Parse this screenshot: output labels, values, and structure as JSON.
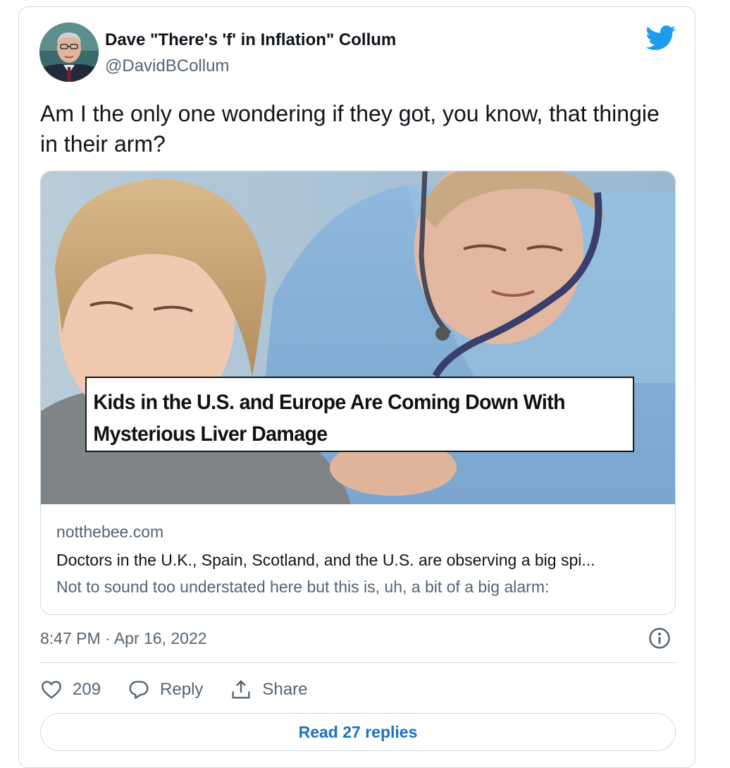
{
  "author": {
    "name": "Dave \"There's 'f' in Inflation\" Collum",
    "handle": "@DavidBCollum"
  },
  "tweet": {
    "text": "Am I the only one wondering if they got, you know, that thingie in their arm?",
    "timestamp": "8:47 PM · Apr 16, 2022"
  },
  "card": {
    "headline_line1": "Kids in the U.S. and Europe Are Coming Down With",
    "headline_line2": "Mysterious Liver Damage",
    "domain": "notthebee.com",
    "title": "Doctors in the U.K., Spain, Scotland, and the U.S. are observing a big spi...",
    "description": "Not to sound too understated here but this is, uh, a bit of a big alarm:"
  },
  "actions": {
    "likes": "209",
    "reply_label": "Reply",
    "share_label": "Share"
  },
  "read_replies_label": "Read 27 replies",
  "icons": {
    "brand": "twitter-bird-icon",
    "info": "info-icon",
    "like": "heart-icon",
    "reply": "speech-bubble-icon",
    "share": "share-upload-icon"
  },
  "colors": {
    "twitter_blue": "#1d9bf0",
    "link_blue": "#1d6fc7",
    "secondary_text": "#536471",
    "border": "#cfd9de"
  }
}
